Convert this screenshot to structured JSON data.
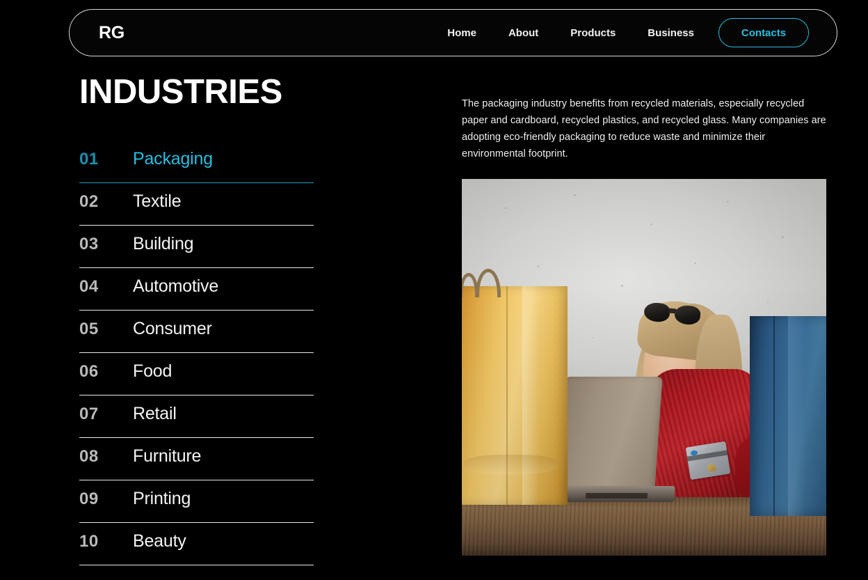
{
  "header": {
    "logo": "RG",
    "nav_links": [
      {
        "label": "Home"
      },
      {
        "label": "About"
      },
      {
        "label": "Products"
      },
      {
        "label": "Business"
      }
    ],
    "cta": {
      "label": "Contacts"
    }
  },
  "main": {
    "title": "INDUSTRIES",
    "industries": [
      {
        "num": "01",
        "label": "Packaging",
        "active": true
      },
      {
        "num": "02",
        "label": "Textile",
        "active": false
      },
      {
        "num": "03",
        "label": "Building",
        "active": false
      },
      {
        "num": "04",
        "label": "Automotive",
        "active": false
      },
      {
        "num": "05",
        "label": "Consumer",
        "active": false
      },
      {
        "num": "06",
        "label": "Food",
        "active": false
      },
      {
        "num": "07",
        "label": "Retail",
        "active": false
      },
      {
        "num": "08",
        "label": "Furniture",
        "active": false
      },
      {
        "num": "09",
        "label": "Printing",
        "active": false
      },
      {
        "num": "10",
        "label": "Beauty",
        "active": false
      }
    ],
    "description": "The packaging industry benefits from recycled materials, especially recycled paper and cardboard, recycled plastics, and recycled glass. Many companies are adopting eco-friendly packaging to reduce waste and minimize their environmental footprint.",
    "photo_alt": "Smiling blonde woman in a red blouse shopping online on a laptop with a credit card, between a yellow paper shopping bag and a blue paper shopping bag on a wooden table"
  },
  "colors": {
    "background": "#000000",
    "accent": "#29bde0",
    "accent_dim": "#1b8fae",
    "text": "#ffffff",
    "muted": "#b9b9b9",
    "divider": "#e8e8e8"
  }
}
